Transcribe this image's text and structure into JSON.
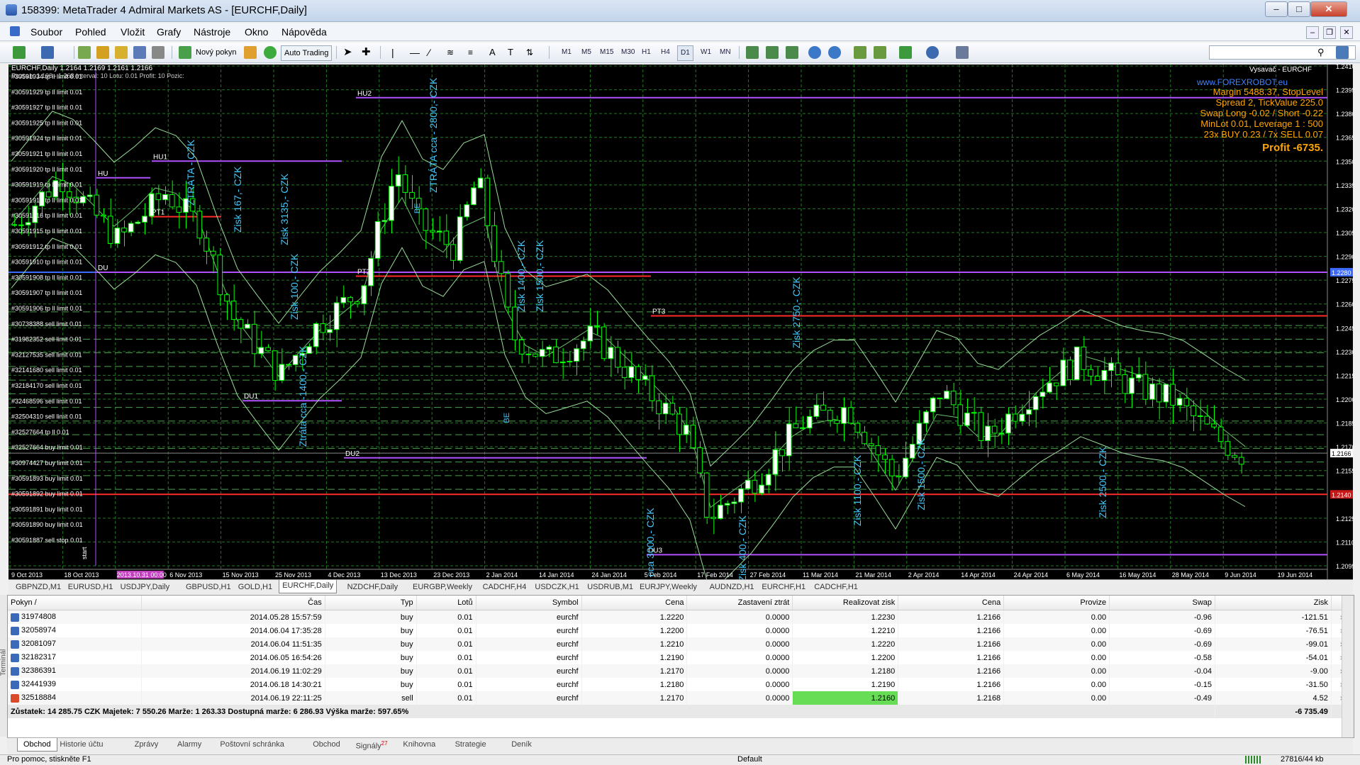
{
  "window": {
    "title": "158399: MetaTrader 4 Admiral Markets AS - [EURCHF,Daily]"
  },
  "menu": [
    "Soubor",
    "Pohled",
    "Vložit",
    "Grafy",
    "Nástroje",
    "Okno",
    "Nápověda"
  ],
  "toolbar": {
    "new_order": "Nový pokyn",
    "auto_trading": "Auto Trading",
    "timeframes": [
      "M1",
      "M5",
      "M15",
      "M30",
      "H1",
      "H4",
      "D1",
      "W1",
      "MN"
    ]
  },
  "chart": {
    "header": "EURCHF,Daily  1.2164 1.2169 1.2161 1.2166",
    "info_line": "Rozsah: 1.198 - 1.268   Interval: 10   Lotu: 0.01   Profit: 10   Pozic:",
    "top_right": "Vysavač - EURCHF",
    "info_panel": {
      "site": "www.FOREXROBOT.eu",
      "lines": [
        "Margin 5488.37, StopLevel",
        "Spread 2, TickValue 225.0",
        "Swap Long -0.02 / Short -0.22",
        "MinLot 0.01, Leverage 1 : 500",
        "23x BUY 0.23 / 7x SELL 0.07"
      ],
      "profit": "Profit -6735."
    },
    "price_labels": [
      "1.2410",
      "1.2395",
      "1.2380",
      "1.2365",
      "1.2350",
      "1.2335",
      "1.2320",
      "1.2305",
      "1.2290",
      "1.2275",
      "1.2260",
      "1.2245",
      "1.2230",
      "1.2215",
      "1.2200",
      "1.2185",
      "1.2170",
      "1.2155",
      "1.2140",
      "1.2125",
      "1.2110",
      "1.2095"
    ],
    "current_price": "1.2166",
    "blue_line_price": "1.2280",
    "red_line_price": "1.2140",
    "date_labels": [
      "9 Oct 2013",
      "18 Oct 2013",
      "2013.10.31 00:00",
      "6 Nov 2013",
      "15 Nov 2013",
      "25 Nov 2013",
      "4 Dec 2013",
      "13 Dec 2013",
      "23 Dec 2013",
      "2 Jan 2014",
      "14 Jan 2014",
      "24 Jan 2014",
      "5 Feb 2014",
      "17 Feb 2014",
      "27 Feb 2014",
      "11 Mar 2014",
      "21 Mar 2014",
      "2 Apr 2014",
      "14 Apr 2014",
      "24 Apr 2014",
      "6 May 2014",
      "16 May 2014",
      "28 May 2014",
      "9 Jun 2014",
      "19 Jun 2014"
    ],
    "order_labels": [
      "#30591934 tp ll limit 0.01",
      "#30591929 tp ll limit 0.01",
      "#30591927 tp ll limit 0.01",
      "#30591925 tp ll limit 0.01",
      "#30591924 tp ll limit 0.01",
      "#30591921 tp ll limit 0.01",
      "#30591920 tp ll limit 0.01",
      "#30591919 tp ll limit 0.01",
      "#30591917 tp ll limit 0.01",
      "#30591916 tp ll limit 0.01",
      "#30591915 tp ll limit 0.01",
      "#30591912 tp ll limit 0.01",
      "#30591910 tp ll limit 0.01",
      "#30591908 tp ll limit 0.01",
      "#30591907 tp ll limit 0.01",
      "#30591906 tp ll limit 0.01",
      "#30738388 sell limit 0.01",
      "#31982352 sell limit 0.01",
      "#32127535 sell limit 0.01",
      "#32141680 sell limit 0.01",
      "#32184170 sell limit 0.01",
      "#32468596 sell limit 0.01",
      "#32504310 sell limit 0.01",
      "#32527664 tp ll 0.01",
      "#32527664 buy limit 0.01",
      "#30974427 buy limit 0.01",
      "#30591893 buy limit 0.01",
      "#30591892 buy limit 0.01",
      "#30591891 buy limit 0.01",
      "#30591890 buy limit 0.01",
      "#30591887 sell stop 0.01"
    ],
    "level_labels": [
      "HU",
      "HU1",
      "HU2",
      "PT1",
      "PT2",
      "PT3",
      "DU",
      "DU1",
      "DU2",
      "DU3",
      "BE",
      "BE",
      "start"
    ],
    "annotations": [
      "ZTRÁTA - CZK",
      "Zisk 167,- CZK",
      "Zisk 3135,- CZK",
      "Zisk 100,- CZK",
      "Ztráta cca -1400,- CZK",
      "ZTRÁTA cca - 2800,- CZK",
      "Zisk 1400,- CZK",
      "Zisk 1500,- CZK",
      "Zisk 2750,- CZK",
      "Ztráta cca 3000,- CZK",
      "Zisk 400,- CZK",
      "Zisk 1100,- CZK",
      "Zisk 1500,- CZK",
      "Zisk 2500,- CZK"
    ]
  },
  "chart_tabs": [
    "GBPNZD,M1",
    "EURUSD,H1",
    "USDJPY,Daily",
    "GBPUSD,H1",
    "GOLD,H1",
    "EURCHF,Daily",
    "NZDCHF,Daily",
    "EURGBP,Weekly",
    "CADCHF,H4",
    "USDCZK,H1",
    "USDRUB,M1",
    "EURJPY,Weekly",
    "AUDNZD,H1",
    "EURCHF,H1",
    "CADCHF,H1"
  ],
  "active_chart_tab": "EURCHF,Daily",
  "terminal": {
    "side_label": "Terminál",
    "columns": [
      "Pokyn",
      "Čas",
      "Typ",
      "Lotů",
      "Symbol",
      "Cena",
      "Zastavení ztrát",
      "Realizovat zisk",
      "Cena",
      "Provize",
      "Swap",
      "Zisk"
    ],
    "rows": [
      {
        "ticket": "31974808",
        "time": "2014.05.28 15:57:59",
        "type": "buy",
        "lots": "0.01",
        "symbol": "eurchf",
        "price": "1.2220",
        "sl": "0.0000",
        "tp": "1.2230",
        "cur": "1.2166",
        "comm": "0.00",
        "swap": "-0.96",
        "profit": "-121.51"
      },
      {
        "ticket": "32058974",
        "time": "2014.06.04 17:35:28",
        "type": "buy",
        "lots": "0.01",
        "symbol": "eurchf",
        "price": "1.2200",
        "sl": "0.0000",
        "tp": "1.2210",
        "cur": "1.2166",
        "comm": "0.00",
        "swap": "-0.69",
        "profit": "-76.51"
      },
      {
        "ticket": "32081097",
        "time": "2014.06.04 11:51:35",
        "type": "buy",
        "lots": "0.01",
        "symbol": "eurchf",
        "price": "1.2210",
        "sl": "0.0000",
        "tp": "1.2220",
        "cur": "1.2166",
        "comm": "0.00",
        "swap": "-0.69",
        "profit": "-99.01"
      },
      {
        "ticket": "32182317",
        "time": "2014.06.05 16:54:26",
        "type": "buy",
        "lots": "0.01",
        "symbol": "eurchf",
        "price": "1.2190",
        "sl": "0.0000",
        "tp": "1.2200",
        "cur": "1.2166",
        "comm": "0.00",
        "swap": "-0.58",
        "profit": "-54.01"
      },
      {
        "ticket": "32386391",
        "time": "2014.06.19 11:02:29",
        "type": "buy",
        "lots": "0.01",
        "symbol": "eurchf",
        "price": "1.2170",
        "sl": "0.0000",
        "tp": "1.2180",
        "cur": "1.2166",
        "comm": "0.00",
        "swap": "-0.04",
        "profit": "-9.00"
      },
      {
        "ticket": "32441939",
        "time": "2014.06.18 14:30:21",
        "type": "buy",
        "lots": "0.01",
        "symbol": "eurchf",
        "price": "1.2180",
        "sl": "0.0000",
        "tp": "1.2190",
        "cur": "1.2166",
        "comm": "0.00",
        "swap": "-0.15",
        "profit": "-31.50"
      },
      {
        "ticket": "32518884",
        "time": "2014.06.19 22:11:25",
        "type": "sell",
        "lots": "0.01",
        "symbol": "eurchf",
        "price": "1.2170",
        "sl": "0.0000",
        "tp": "1.2160",
        "cur": "1.2168",
        "comm": "0.00",
        "swap": "-0.49",
        "profit": "4.52"
      }
    ],
    "summary": "Zůstatek: 14 285.75 CZK  Majetek: 7 550.26  Marže: 1 263.33  Dostupná marže: 6 286.93  Výška marže: 597.65%",
    "summary_profit": "-6 735.49",
    "tabs": [
      "Obchod",
      "Historie účtu",
      "Zprávy",
      "Alarmy",
      "Poštovní schránka",
      "Obchod",
      "Signály",
      "Knihovna",
      "Strategie",
      "Deník"
    ],
    "signals_badge": "27"
  },
  "status": {
    "left": "Pro pomoc, stiskněte F1",
    "profile": "Default",
    "traffic": "27816/44 kb"
  },
  "colors": {
    "candle": "#00ff00",
    "grid": "#1f7a1f",
    "level_purple": "#b050ff",
    "level_red": "#ff2a2a",
    "text_cyan": "#40c8ff",
    "info_orange": "#ffa500",
    "highlight": "#66dd55"
  }
}
